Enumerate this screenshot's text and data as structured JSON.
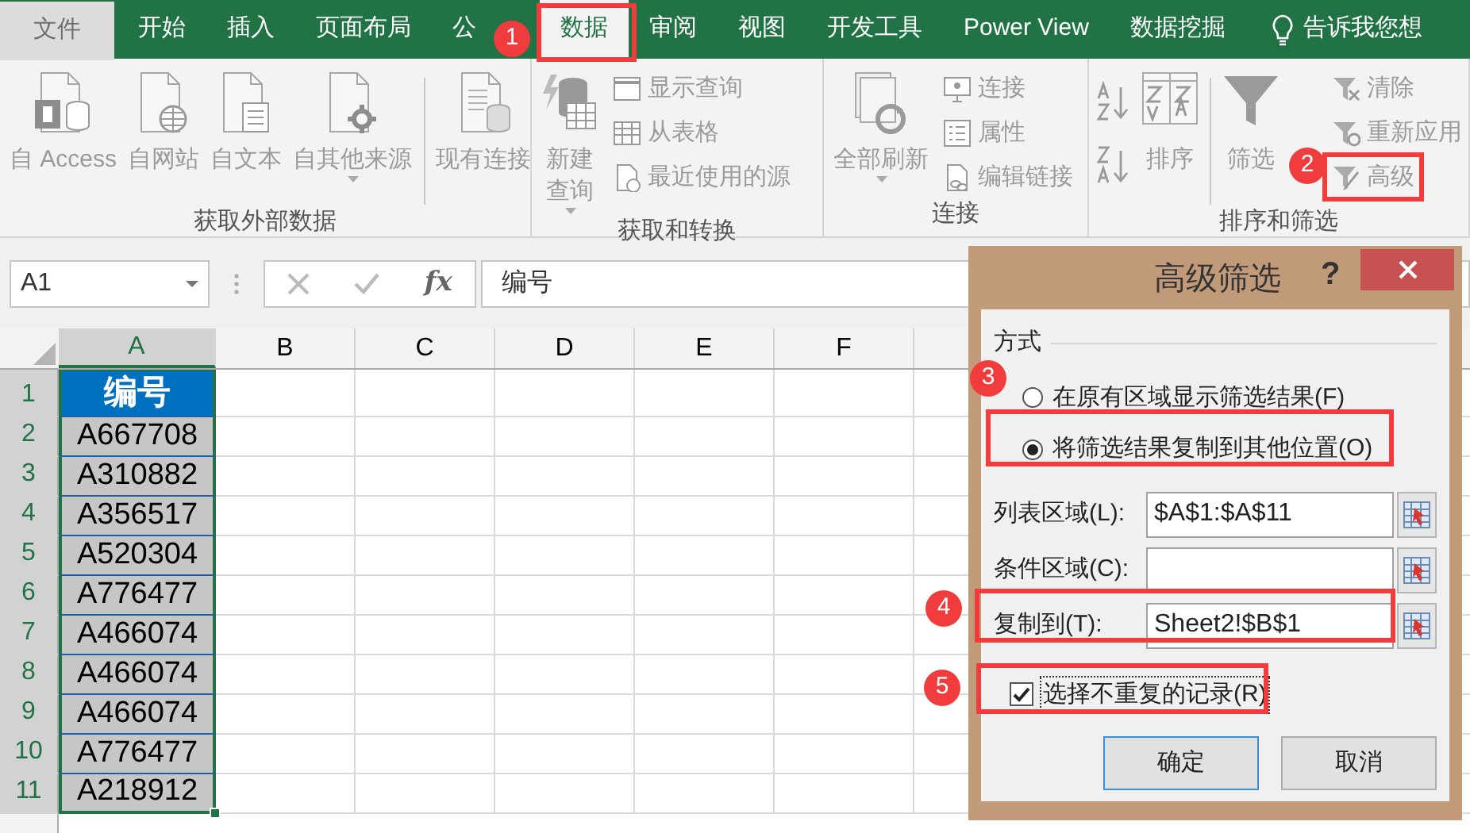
{
  "ribbon_tabs": [
    {
      "label": "文件",
      "kind": "file",
      "selected": false
    },
    {
      "label": "开始",
      "kind": "tab",
      "selected": false
    },
    {
      "label": "插入",
      "kind": "tab",
      "selected": false
    },
    {
      "label": "页面布局",
      "kind": "tab",
      "selected": false
    },
    {
      "label": "公",
      "kind": "tab",
      "selected": false
    },
    {
      "label": "数据",
      "kind": "tab",
      "selected": true
    },
    {
      "label": "审阅",
      "kind": "tab",
      "selected": false
    },
    {
      "label": "视图",
      "kind": "tab",
      "selected": false
    },
    {
      "label": "开发工具",
      "kind": "tab",
      "selected": false
    },
    {
      "label": "Power View",
      "kind": "tab",
      "selected": false
    },
    {
      "label": "数据挖掘",
      "kind": "tab",
      "selected": false
    }
  ],
  "tell_me": "告诉我您想",
  "ribbon_groups": [
    {
      "label": "获取外部数据",
      "commands": [
        {
          "kind": "large",
          "label": "自 Access"
        },
        {
          "kind": "large",
          "label": "自网站"
        },
        {
          "kind": "large",
          "label": "自文本"
        },
        {
          "kind": "large",
          "label": "自其他来源",
          "dropdown": true
        },
        {
          "kind": "large",
          "label": "现有连接",
          "separator_before": true
        }
      ]
    },
    {
      "label": "获取和转换",
      "commands": [
        {
          "kind": "large",
          "label": "新建查询",
          "dropdown": true
        },
        {
          "kind": "stack",
          "items": [
            {
              "label": "显示查询"
            },
            {
              "label": "从表格"
            },
            {
              "label": "最近使用的源"
            }
          ]
        }
      ]
    },
    {
      "label": "连接",
      "commands": [
        {
          "kind": "large",
          "label": "全部刷新",
          "dropdown": true
        },
        {
          "kind": "stack",
          "items": [
            {
              "label": "连接"
            },
            {
              "label": "属性"
            },
            {
              "label": "编辑链接"
            }
          ]
        }
      ]
    },
    {
      "label": "排序和筛选",
      "commands": [
        {
          "kind": "icons"
        },
        {
          "kind": "large",
          "label": "排序"
        },
        {
          "kind": "large",
          "label": "筛选",
          "separator_before": true
        },
        {
          "kind": "stack",
          "items": [
            {
              "label": "清除"
            },
            {
              "label": "重新应用"
            },
            {
              "label": "高级"
            }
          ]
        }
      ]
    }
  ],
  "formula_bar": {
    "name_box": "A1",
    "function_label": "fx",
    "formula": "编号"
  },
  "columns": [
    {
      "label": "A",
      "selected": true
    },
    {
      "label": "B",
      "selected": false
    },
    {
      "label": "C",
      "selected": false
    },
    {
      "label": "D",
      "selected": false
    },
    {
      "label": "E",
      "selected": false
    },
    {
      "label": "F",
      "selected": false
    }
  ],
  "rows": [
    {
      "number": "1",
      "value": "编号",
      "kind": "heading",
      "selected": true
    },
    {
      "number": "2",
      "value": "A667708",
      "kind": "data",
      "selected": true
    },
    {
      "number": "3",
      "value": "A310882",
      "kind": "data",
      "selected": true
    },
    {
      "number": "4",
      "value": "A356517",
      "kind": "data",
      "selected": true
    },
    {
      "number": "5",
      "value": "A520304",
      "kind": "data",
      "selected": true
    },
    {
      "number": "6",
      "value": "A776477",
      "kind": "data",
      "selected": true
    },
    {
      "number": "7",
      "value": "A466074",
      "kind": "data",
      "selected": true
    },
    {
      "number": "8",
      "value": "A466074",
      "kind": "data",
      "selected": true
    },
    {
      "number": "9",
      "value": "A466074",
      "kind": "data",
      "selected": true
    },
    {
      "number": "10",
      "value": "A776477",
      "kind": "data",
      "selected": true
    },
    {
      "number": "11",
      "value": "A218912",
      "kind": "data",
      "selected": true
    }
  ],
  "dialog": {
    "title": "高级筛选",
    "help": "?",
    "section": "方式",
    "radios": [
      {
        "label": "在原有区域显示筛选结果(F)",
        "selected": false
      },
      {
        "label": "将筛选结果复制到其他位置(O)",
        "selected": true
      }
    ],
    "fields": [
      {
        "label": "列表区域(L):",
        "value": "$A$1:$A$11"
      },
      {
        "label": "条件区域(C):"
      },
      {
        "label": "复制到(T):",
        "value": "Sheet2!$B$1"
      }
    ],
    "checkbox": {
      "label": "选择不重复的记录(R)",
      "checked": true
    },
    "buttons": [
      {
        "label": "确定",
        "default": true
      },
      {
        "label": "取消",
        "default": false
      }
    ]
  },
  "annotations": [
    {
      "label": "1"
    },
    {
      "label": "2"
    },
    {
      "label": "3"
    },
    {
      "label": "4"
    },
    {
      "label": "5"
    }
  ]
}
